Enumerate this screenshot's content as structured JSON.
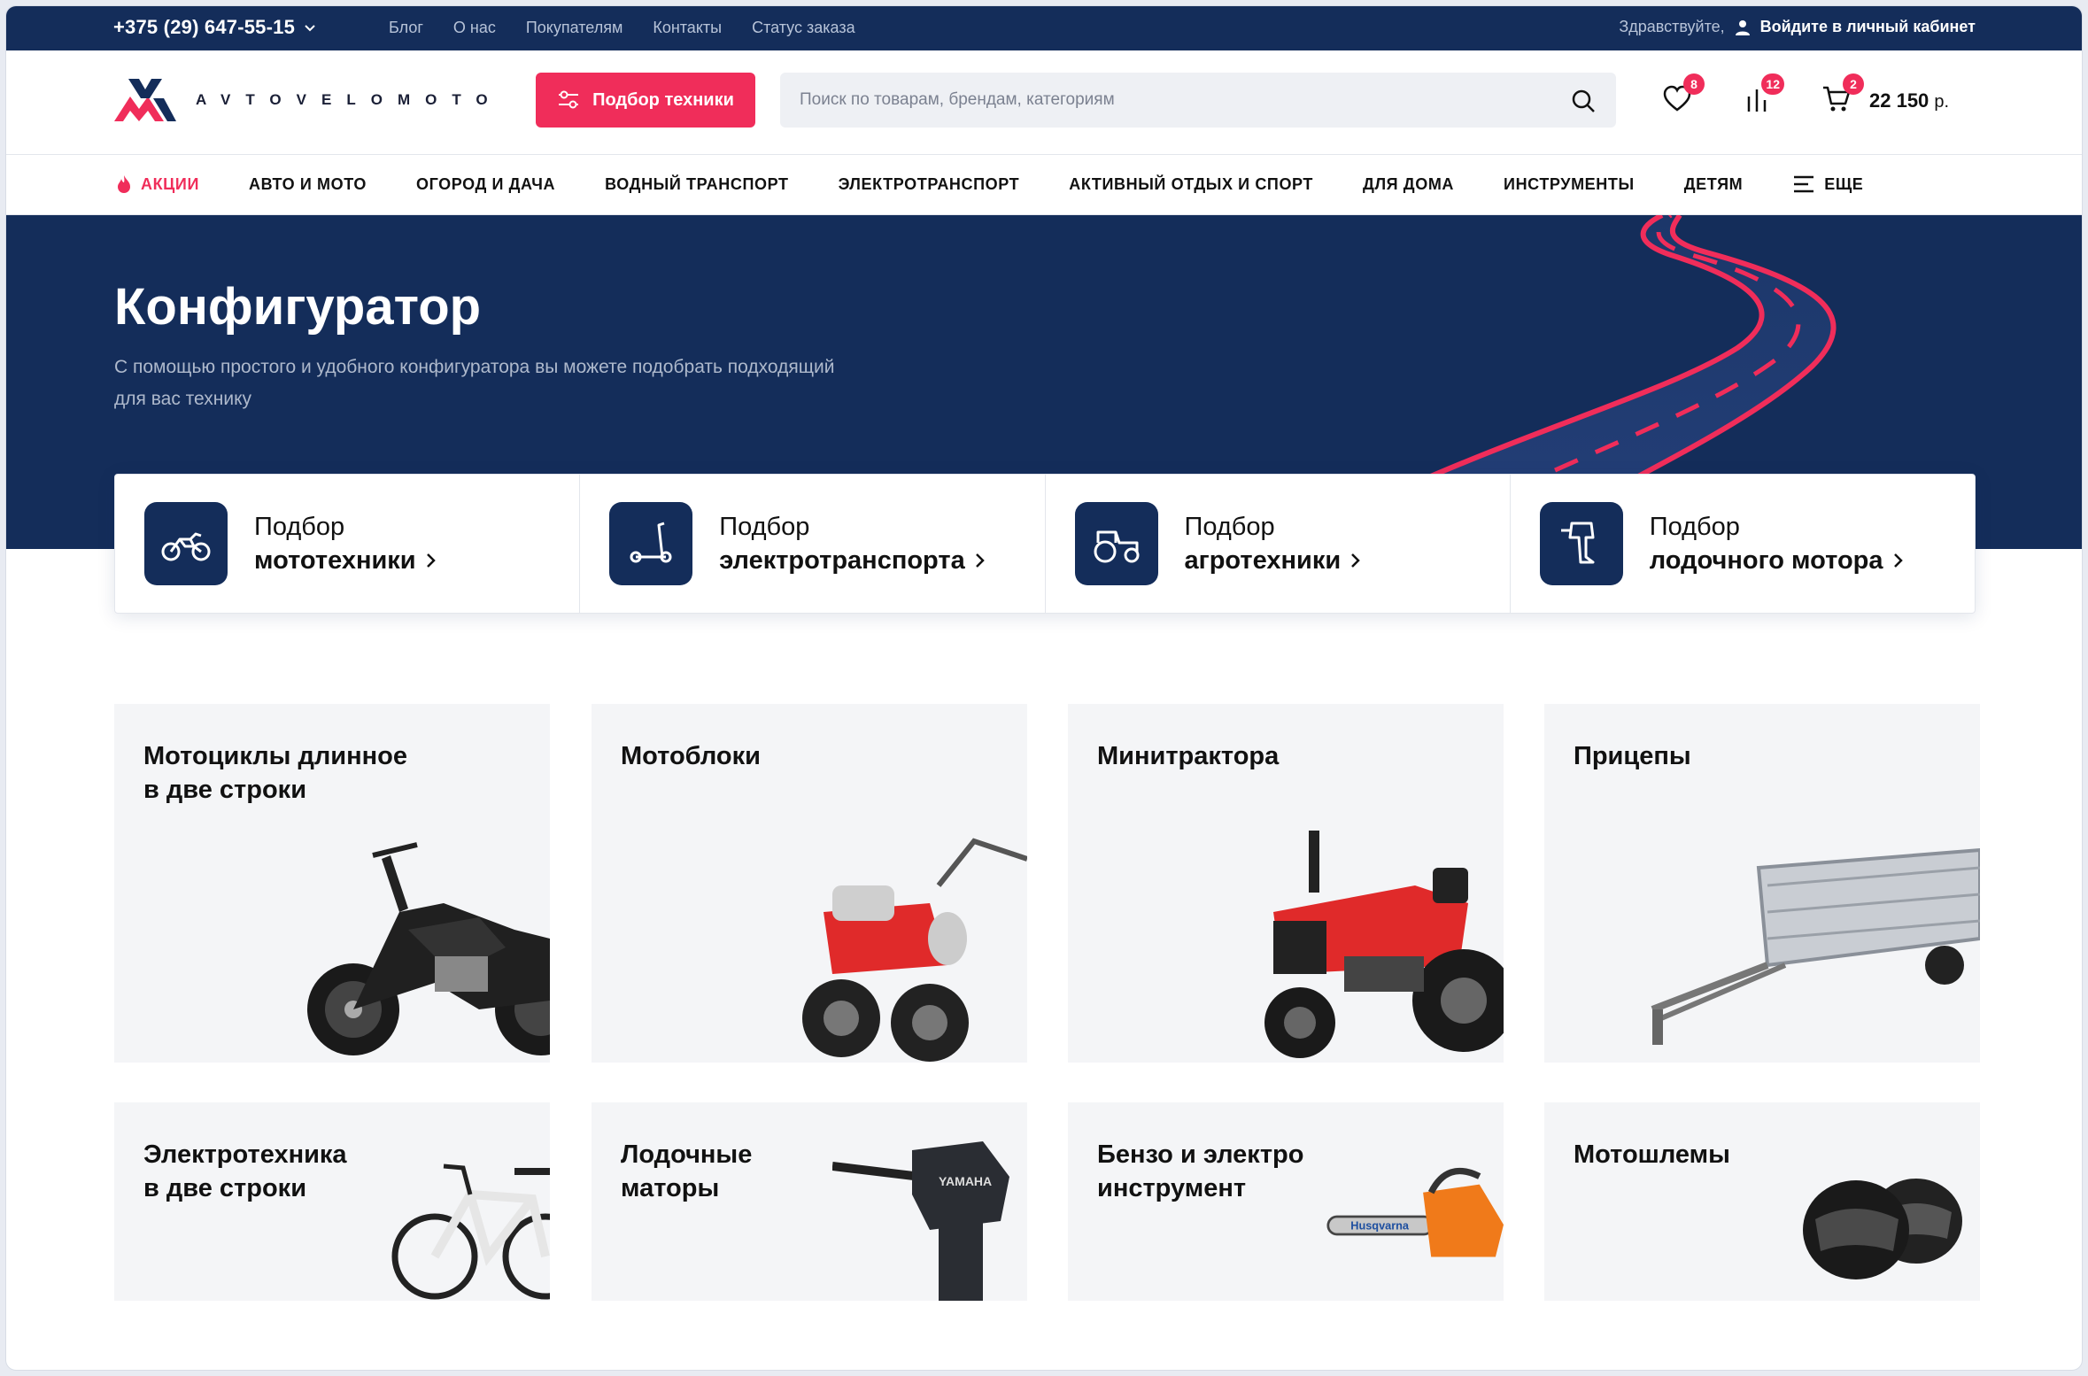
{
  "topbar": {
    "phone": "+375 (29) 647-55-15",
    "links": [
      "Блог",
      "О нас",
      "Покупателям",
      "Контакты",
      "Статус заказа"
    ],
    "greeting": "Здравствуйте,",
    "login": "Войдите в личный кабинет"
  },
  "header": {
    "logo_text": "AVTOVELOMOTO",
    "pick_button": "Подбор техники",
    "search_placeholder": "Поиск по товарам, брендам, категориям",
    "favorites_count": "8",
    "compare_count": "12",
    "cart_count": "2",
    "cart_total": "22 150",
    "cart_currency": "р."
  },
  "nav": {
    "items": [
      "АКЦИИ",
      "АВТО И МОТО",
      "ОГОРОД И ДАЧА",
      "ВОДНЫЙ ТРАНСПОРТ",
      "ЭЛЕКТРОТРАНСПОРТ",
      "АКТИВНЫЙ ОТДЫХ И СПОРТ",
      "ДЛЯ ДОМА",
      "ИНСТРУМЕНТЫ",
      "ДЕТЯМ",
      "ЕЩЕ"
    ]
  },
  "hero": {
    "title": "Конфигуратор",
    "subtitle": "С помощью простого и удобного конфигуратора вы можете подобрать подходящий для вас технику"
  },
  "pickers": [
    {
      "line1": "Подбор",
      "line2": "мототехники",
      "icon": "motorcycle-icon"
    },
    {
      "line1": "Подбор",
      "line2": "электротранспорта",
      "icon": "scooter-icon"
    },
    {
      "line1": "Подбор",
      "line2": "агротехники",
      "icon": "tractor-icon"
    },
    {
      "line1": "Подбор",
      "line2": "лодочного мотора",
      "icon": "outboard-motor-icon"
    }
  ],
  "categories": [
    {
      "title1": "Мотоциклы длинное",
      "title2": "в две строки"
    },
    {
      "title1": "Мотоблоки",
      "title2": ""
    },
    {
      "title1": "Минитрактора",
      "title2": ""
    },
    {
      "title1": "Прицепы",
      "title2": ""
    },
    {
      "title1": "Электротехника",
      "title2": "в две строки"
    },
    {
      "title1": "Лодочные",
      "title2": "маторы"
    },
    {
      "title1": "Бензо и электро",
      "title2": "инструмент"
    },
    {
      "title1": "Мотошлемы",
      "title2": ""
    }
  ],
  "colors": {
    "navy": "#142d5a",
    "accent": "#f02d5a",
    "card_bg": "#f4f5f7"
  }
}
